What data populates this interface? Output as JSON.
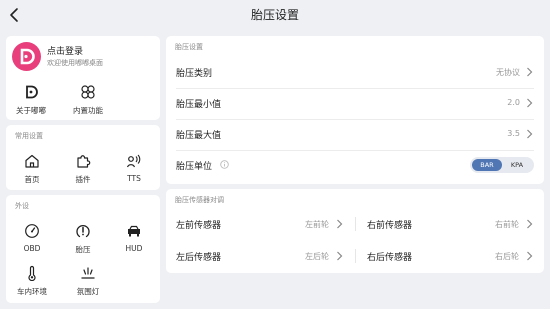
{
  "header": {
    "title": "胎压设置",
    "back_icon": "back-arrow-icon"
  },
  "login": {
    "name": "点击登录",
    "subtitle": "欢迎使用嘟嘟桌面",
    "avatar_color": "#e83e7c"
  },
  "account_menu": [
    {
      "label": "关于嘟嘟",
      "icon": "dudu-logo-icon"
    },
    {
      "label": "内置功能",
      "icon": "knot-icon"
    }
  ],
  "common": {
    "title": "常用设置",
    "items": [
      {
        "label": "首页",
        "icon": "home-icon"
      },
      {
        "label": "插件",
        "icon": "puzzle-icon"
      },
      {
        "label": "TTS",
        "icon": "voice-icon"
      }
    ]
  },
  "peripheral": {
    "title": "外设",
    "items": [
      {
        "label": "OBD",
        "icon": "gauge-icon"
      },
      {
        "label": "胎压",
        "icon": "tire-pressure-icon"
      },
      {
        "label": "HUD",
        "icon": "car-hud-icon"
      },
      {
        "label": "车内环境",
        "icon": "thermometer-icon"
      },
      {
        "label": "氛围灯",
        "icon": "ambient-light-icon"
      }
    ]
  },
  "settings": {
    "title": "胎压设置",
    "type_label": "胎压类别",
    "type_value": "无协议",
    "min_label": "胎压最小值",
    "min_value": "2.0",
    "max_label": "胎压最大值",
    "max_value": "3.5",
    "unit_label": "胎压单位",
    "unit_options": [
      "BAR",
      "KPA"
    ],
    "unit_selected": "BAR",
    "accent_color": "#5176b4"
  },
  "calibration": {
    "title": "胎压传感器对调",
    "front_left_label": "左前传感器",
    "front_left_value": "左前轮",
    "front_right_label": "右前传感器",
    "front_right_value": "右前轮",
    "rear_left_label": "左后传感器",
    "rear_left_value": "左后轮",
    "rear_right_label": "右后传感器",
    "rear_right_value": "右后轮"
  }
}
